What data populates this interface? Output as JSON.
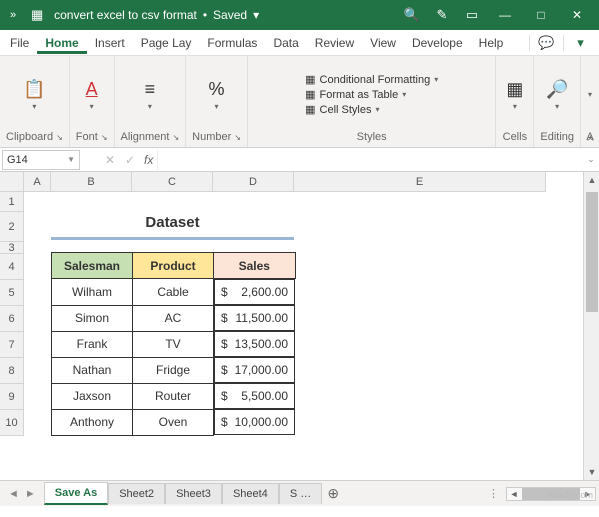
{
  "title": {
    "filename": "convert excel to csv format",
    "status": "Saved"
  },
  "win": {
    "min": "—",
    "max": "□",
    "close": "✕"
  },
  "menu": {
    "file": "File",
    "home": "Home",
    "insert": "Insert",
    "pageLayout": "Page Lay",
    "formulas": "Formulas",
    "data": "Data",
    "review": "Review",
    "view": "View",
    "developer": "Develope",
    "help": "Help"
  },
  "ribbon": {
    "clipboard": "Clipboard",
    "font": "Font",
    "alignment": "Alignment",
    "number": "Number",
    "styles": "Styles",
    "cells": "Cells",
    "editing": "Editing",
    "condFmt": "Conditional Formatting",
    "fmtTable": "Format as Table",
    "cellStyles": "Cell Styles"
  },
  "namebox": "G14",
  "fx": "fx",
  "cols": {
    "A": "A",
    "B": "B",
    "C": "C",
    "D": "D",
    "E": "E"
  },
  "rows": [
    "1",
    "2",
    "3",
    "4",
    "5",
    "6",
    "7",
    "8",
    "9",
    "10"
  ],
  "dataset": {
    "title": "Dataset",
    "headers": {
      "salesman": "Salesman",
      "product": "Product",
      "sales": "Sales"
    },
    "cur": "$",
    "rows": [
      {
        "salesman": "Wilham",
        "product": "Cable",
        "sales": "2,600.00"
      },
      {
        "salesman": "Simon",
        "product": "AC",
        "sales": "11,500.00"
      },
      {
        "salesman": "Frank",
        "product": "TV",
        "sales": "13,500.00"
      },
      {
        "salesman": "Nathan",
        "product": "Fridge",
        "sales": "17,000.00"
      },
      {
        "salesman": "Jaxson",
        "product": "Router",
        "sales": "5,500.00"
      },
      {
        "salesman": "Anthony",
        "product": "Oven",
        "sales": "10,000.00"
      }
    ]
  },
  "tabs": {
    "active": "Save As",
    "t2": "Sheet2",
    "t3": "Sheet3",
    "t4": "Sheet4",
    "t5": "S …",
    "add": "⊕"
  },
  "watermark": "wsxdn.com"
}
